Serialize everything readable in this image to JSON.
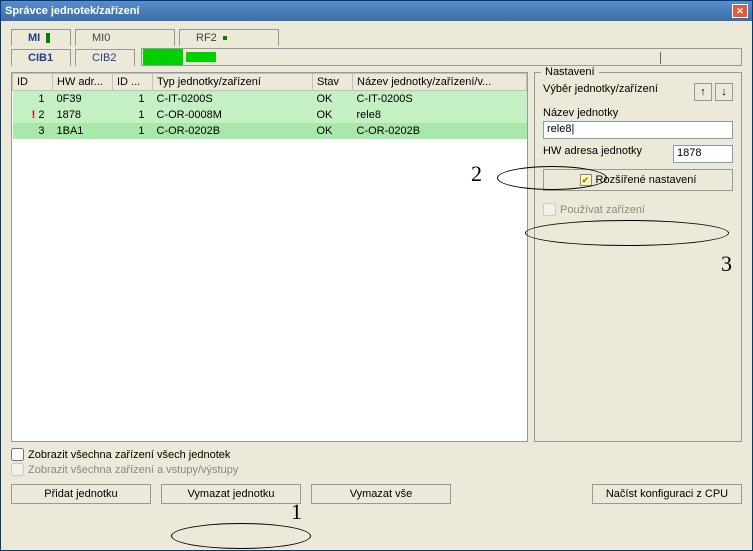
{
  "window": {
    "title": "Správce jednotek/zařízení"
  },
  "tabs_top": [
    "MI",
    "MI0",
    "RF2"
  ],
  "tabs_bot": [
    "CIB1",
    "CIB2"
  ],
  "table": {
    "headers": [
      "ID",
      "HW adr...",
      "ID ...",
      "Typ jednotky/zařízení",
      "Stav",
      "Název jednotky/zařízení/v..."
    ],
    "rows": [
      {
        "id": "1",
        "hw": "0F39",
        "id2": "1",
        "typ": "C-IT-0200S",
        "stav": "OK",
        "nazev": "C-IT-0200S",
        "warn": false,
        "sel": false
      },
      {
        "id": "2",
        "hw": "1878",
        "id2": "1",
        "typ": "C-OR-0008M",
        "stav": "OK",
        "nazev": "rele8",
        "warn": true,
        "sel": false
      },
      {
        "id": "3",
        "hw": "1BA1",
        "id2": "1",
        "typ": "C-OR-0202B",
        "stav": "OK",
        "nazev": "C-OR-0202B",
        "warn": false,
        "sel": true
      }
    ]
  },
  "settings": {
    "legend": "Nastavení",
    "select_label": "Výběr jednotky/zařízení",
    "name_label": "Název jednotky",
    "name_value": "rele8|",
    "hw_label": "HW adresa jednotky",
    "hw_value": "1878",
    "advanced_label": "Rozšířené nastavení",
    "use_device_label": "Používat zařízení"
  },
  "checks": {
    "show_all": "Zobrazit všechna zařízení všech jednotek",
    "show_io": "Zobrazit všechna zařízení a vstupy/výstupy"
  },
  "buttons": {
    "add": "Přidat jednotku",
    "del": "Vymazat jednotku",
    "del_all": "Vymazat vše",
    "load": "Načíst konfiguraci z CPU"
  },
  "annotations": {
    "a1": "1",
    "a2": "2",
    "a3": "3"
  }
}
